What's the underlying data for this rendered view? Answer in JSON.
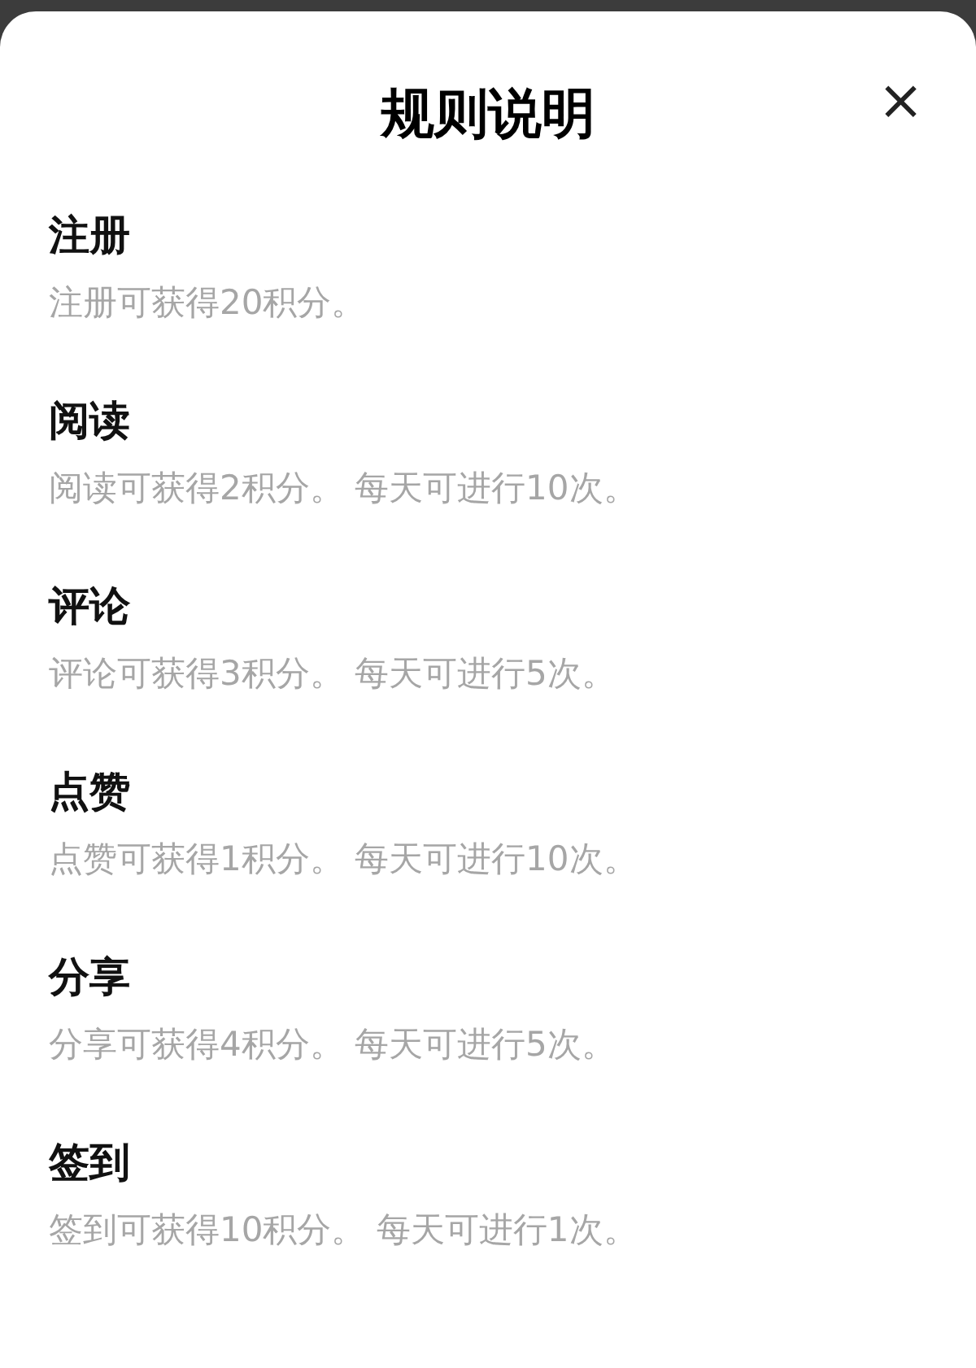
{
  "dialog": {
    "title": "规则说明",
    "close": "×"
  },
  "rules": [
    {
      "title": "注册",
      "description": "注册可获得20积分。"
    },
    {
      "title": "阅读",
      "description": "阅读可获得2积分。 每天可进行10次。"
    },
    {
      "title": "评论",
      "description": "评论可获得3积分。 每天可进行5次。"
    },
    {
      "title": "点赞",
      "description": "点赞可获得1积分。 每天可进行10次。"
    },
    {
      "title": "分享",
      "description": "分享可获得4积分。 每天可进行5次。"
    },
    {
      "title": "签到",
      "description": "签到可获得10积分。 每天可进行1次。"
    }
  ]
}
